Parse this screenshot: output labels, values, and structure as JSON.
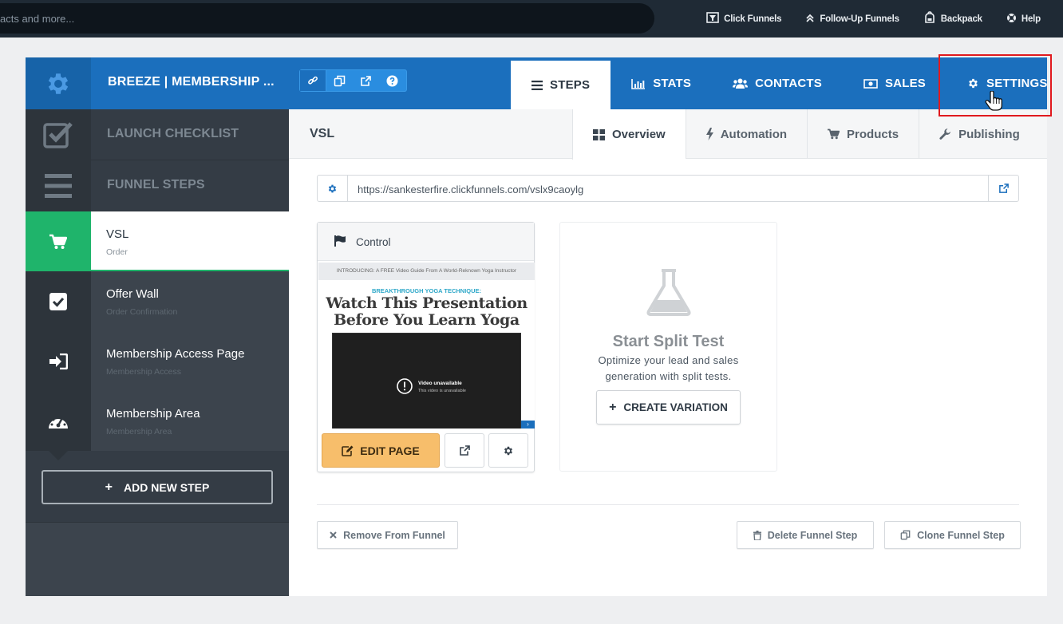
{
  "topbar": {
    "search_placeholder": "acts and more...",
    "links": [
      {
        "label": "Click Funnels",
        "icon": "clickfunnels-logo-icon"
      },
      {
        "label": "Follow-Up Funnels",
        "icon": "double-chevron-up-icon"
      },
      {
        "label": "Backpack",
        "icon": "backpack-icon"
      },
      {
        "label": "Help",
        "icon": "life-ring-icon"
      }
    ]
  },
  "header": {
    "funnel_title": "BREEZE | MEMBERSHIP ...",
    "tools": [
      "link-icon",
      "copy-icon",
      "external-link-icon",
      "question-icon"
    ],
    "tabs": [
      {
        "label": "STEPS",
        "icon": "bars-icon"
      },
      {
        "label": "STATS",
        "icon": "bar-chart-icon"
      },
      {
        "label": "CONTACTS",
        "icon": "users-icon"
      },
      {
        "label": "SALES",
        "icon": "money-icon"
      },
      {
        "label": "SETTINGS",
        "icon": "gear-icon"
      }
    ],
    "active_tab": "STEPS"
  },
  "sidebar": {
    "launch_checklist": "LAUNCH CHECKLIST",
    "funnel_steps": "FUNNEL STEPS",
    "steps": [
      {
        "name": "VSL",
        "type": "Order",
        "icon": "cart-icon"
      },
      {
        "name": "Offer Wall",
        "type": "Order Confirmation",
        "icon": "check-square-icon"
      },
      {
        "name": "Membership Access Page",
        "type": "Membership Access",
        "icon": "sign-in-icon"
      },
      {
        "name": "Membership Area",
        "type": "Membership Area",
        "icon": "dashboard-icon"
      }
    ],
    "add_step": "ADD NEW STEP"
  },
  "main": {
    "step_title": "VSL",
    "subtabs": [
      {
        "label": "Overview",
        "icon": "grid-icon"
      },
      {
        "label": "Automation",
        "icon": "bolt-icon"
      },
      {
        "label": "Products",
        "icon": "cart-icon"
      },
      {
        "label": "Publishing",
        "icon": "wrench-icon"
      }
    ],
    "active_subtab": "Overview",
    "url": "https://sankesterfire.clickfunnels.com/vslx9caoylg",
    "control": {
      "label": "Control",
      "preview_top": "INTRODUCING: A FREE Video Guide From A World-Reknown Yoga Instructor",
      "preview_kicker": "BREAKTHROUGH YOGA TECHNIQUE:",
      "preview_headline_1": "Watch This Presentation",
      "preview_headline_2": "Before You Learn Yoga",
      "video_title": "Video unavailable",
      "video_sub": "This video is unavailable",
      "edit_label": "EDIT PAGE"
    },
    "split": {
      "title": "Start Split Test",
      "desc": "Optimize your lead and sales generation with split tests.",
      "button": "CREATE VARIATION"
    },
    "footer": {
      "remove": "Remove From Funnel",
      "delete": "Delete Funnel Step",
      "clone": "Clone Funnel Step"
    }
  },
  "colors": {
    "header_blue": "#1b6fbd",
    "active_step_green": "#1fb46b",
    "edit_button": "#f7be6b",
    "highlight_red": "#e0191e"
  }
}
